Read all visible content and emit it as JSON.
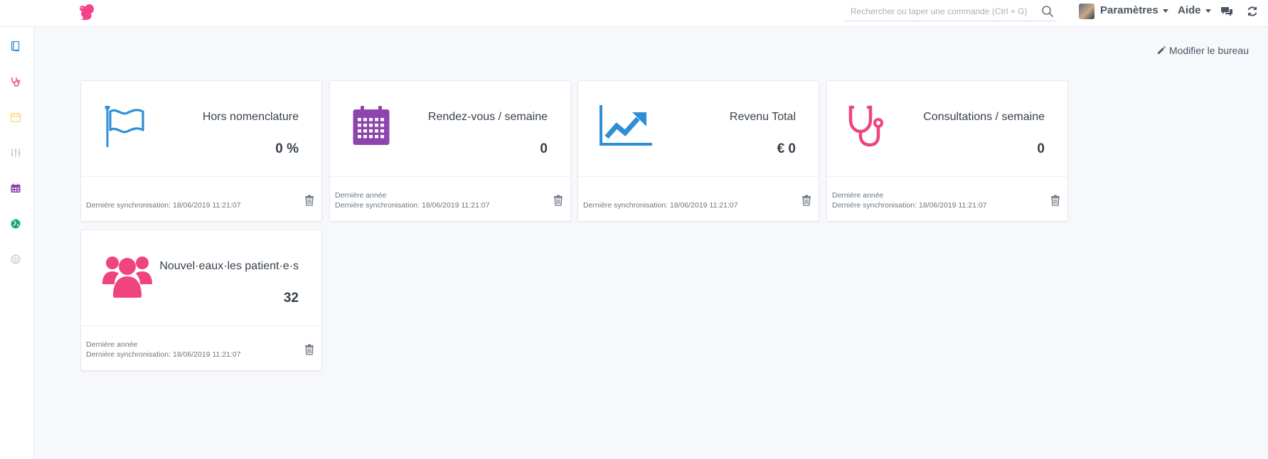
{
  "navbar": {
    "search_placeholder": "Rechercher ou taper une commande (Ctrl + G)",
    "settings_label": "Paramètres",
    "help_label": "Aide"
  },
  "toolbar": {
    "edit_desk_label": "Modifier le bureau"
  },
  "colors": {
    "brand": "#f7428b",
    "blue": "#2f8fd6",
    "purple": "#8e44ad",
    "pink": "#f0447f"
  },
  "sidebar": {
    "icons": [
      "book-icon",
      "stethoscope-icon",
      "calendar-icon",
      "sliders-icon",
      "calendar-grid-icon",
      "globe-icon",
      "brain-icon"
    ]
  },
  "cards": [
    {
      "title": "Hors nomenclature",
      "value": "0 %",
      "period": "",
      "sync": "Dernière synchronisation: 18/06/2019 11:21:07",
      "icon": "flag-icon"
    },
    {
      "title": "Rendez-vous / semaine",
      "value": "0",
      "period": "Dernière année",
      "sync": "Dernière synchronisation: 18/06/2019 11:21:07",
      "icon": "calendar-icon"
    },
    {
      "title": "Revenu Total",
      "value": "€ 0",
      "period": "",
      "sync": "Dernière synchronisation: 18/06/2019 11:21:07",
      "icon": "chart-line-icon"
    },
    {
      "title": "Consultations / semaine",
      "value": "0",
      "period": "Dernière année",
      "sync": "Dernière synchronisation: 18/06/2019 11:21:07",
      "icon": "stethoscope-icon"
    },
    {
      "title": "Nouvel·eaux·les patient·e·s",
      "value": "32",
      "period": "Dernière année",
      "sync": "Dernière synchronisation: 18/06/2019 11:21:07",
      "icon": "users-icon"
    }
  ]
}
